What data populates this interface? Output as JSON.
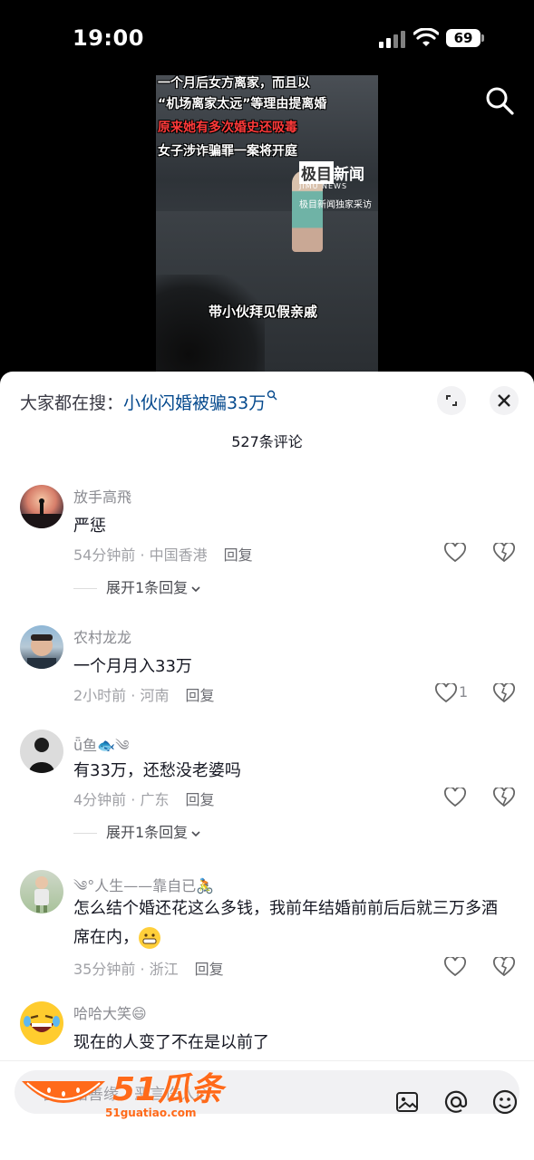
{
  "status": {
    "time": "19:00",
    "battery": "69"
  },
  "video": {
    "captions": [
      "一个月后女方离家，而且以",
      "“机场离家太远”等理由提离婚",
      "原来她有多次婚史还吸毒",
      "女子涉诈骗罪一案将开庭"
    ],
    "logo_main": "极目新闻",
    "logo_sub": "JIMU NEWS",
    "logo_exclusive": "极目新闻独家采访",
    "bottom_caption": "带小伙拜见假亲戚"
  },
  "sheet": {
    "hot_search_label": "大家都在搜：",
    "hot_search_link": "小伙闪婚被骗33万",
    "comment_count": "527条评论"
  },
  "comments": [
    {
      "user": "放手高飛",
      "text": "严惩",
      "time": "54分钟前 · 中国香港",
      "reply": "回复",
      "likes": "",
      "expand": "展开1条回复"
    },
    {
      "user": "农村龙龙",
      "text": "一个月月入33万",
      "time": "2小时前 · 河南",
      "reply": "回复",
      "likes": "1",
      "expand": ""
    },
    {
      "user": "ǖ鱼🐟༄",
      "text": "有33万，还愁没老婆吗",
      "time": "4分钟前 · 广东",
      "reply": "回复",
      "likes": "",
      "expand": "展开1条回复"
    },
    {
      "user": "༄°人生——靠自已🚴",
      "text": "怎么结个婚还花这么多钱，我前年结婚前前后后就三万多酒席在内，",
      "time": "35分钟前 · 浙江",
      "reply": "回复",
      "likes": "",
      "expand": ""
    },
    {
      "user": "哈哈大笑😄",
      "text": "现在的人变了不在是以前了",
      "time": "",
      "reply": "",
      "likes": "",
      "expand": ""
    }
  ],
  "input": {
    "placeholder": "善语结善缘，恶言伤人心",
    "watermark": "51瓜条",
    "watermark_url": "51guatiao.com"
  },
  "icons": {
    "search": "search-icon",
    "expand": "expand-icon",
    "close": "close-icon",
    "like": "heart-icon",
    "dislike": "broken-heart-icon",
    "image": "image-icon",
    "at": "at-icon",
    "emoji": "emoji-icon"
  },
  "colors": {
    "link": "#04498d",
    "watermark": "#ff6a1a",
    "caption_red": "#ff3a3a"
  }
}
